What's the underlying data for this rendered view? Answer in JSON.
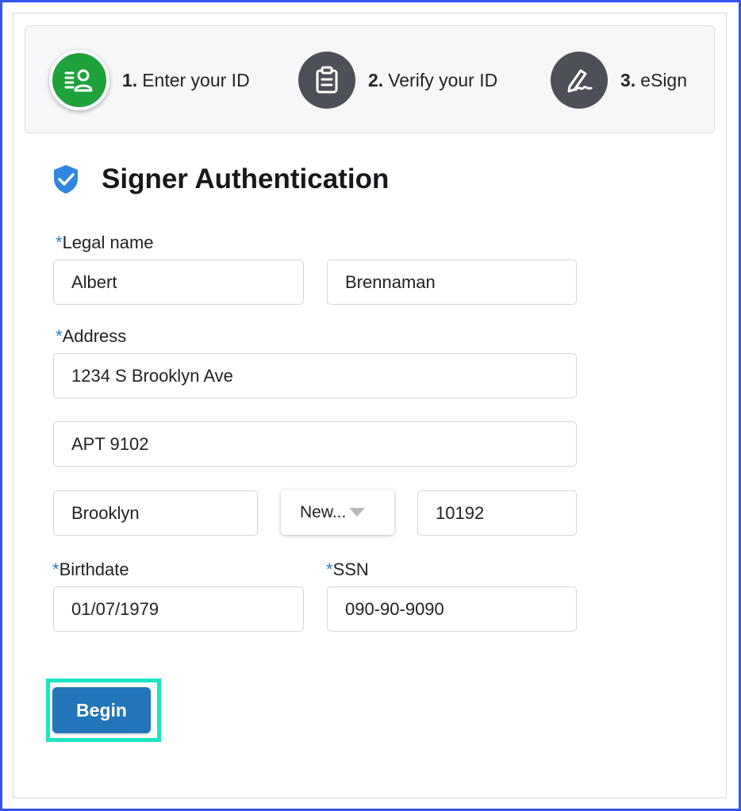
{
  "steps": [
    {
      "number": "1.",
      "label": "Enter your ID",
      "state": "active",
      "icon": "id-card-icon"
    },
    {
      "number": "2.",
      "label": "Verify your ID",
      "state": "inactive",
      "icon": "clipboard-icon"
    },
    {
      "number": "3.",
      "label": "eSign",
      "state": "inactive",
      "icon": "signature-pen-icon"
    }
  ],
  "header": {
    "title": "Signer Authentication",
    "icon": "shield-check-icon"
  },
  "form": {
    "required_marker": "*",
    "legal_name_label": "Legal name",
    "first_name": "Albert",
    "last_name": "Brennaman",
    "address_label": "Address",
    "address_line1": "1234 S Brooklyn Ave",
    "address_line2": "APT 9102",
    "city": "Brooklyn",
    "state": "New...",
    "zip": "10192",
    "birthdate_label": "Birthdate",
    "birthdate": "01/07/1979",
    "ssn_label": "SSN",
    "ssn": "090-90-9090"
  },
  "actions": {
    "begin_label": "Begin"
  },
  "colors": {
    "active_step": "#1fa23b",
    "inactive_step": "#4d5057",
    "primary_button": "#2175b8",
    "required_marker": "#2a7bbf",
    "shield": "#2f86e0",
    "highlight": "#1de5c3",
    "frame_border": "#3355ee"
  }
}
